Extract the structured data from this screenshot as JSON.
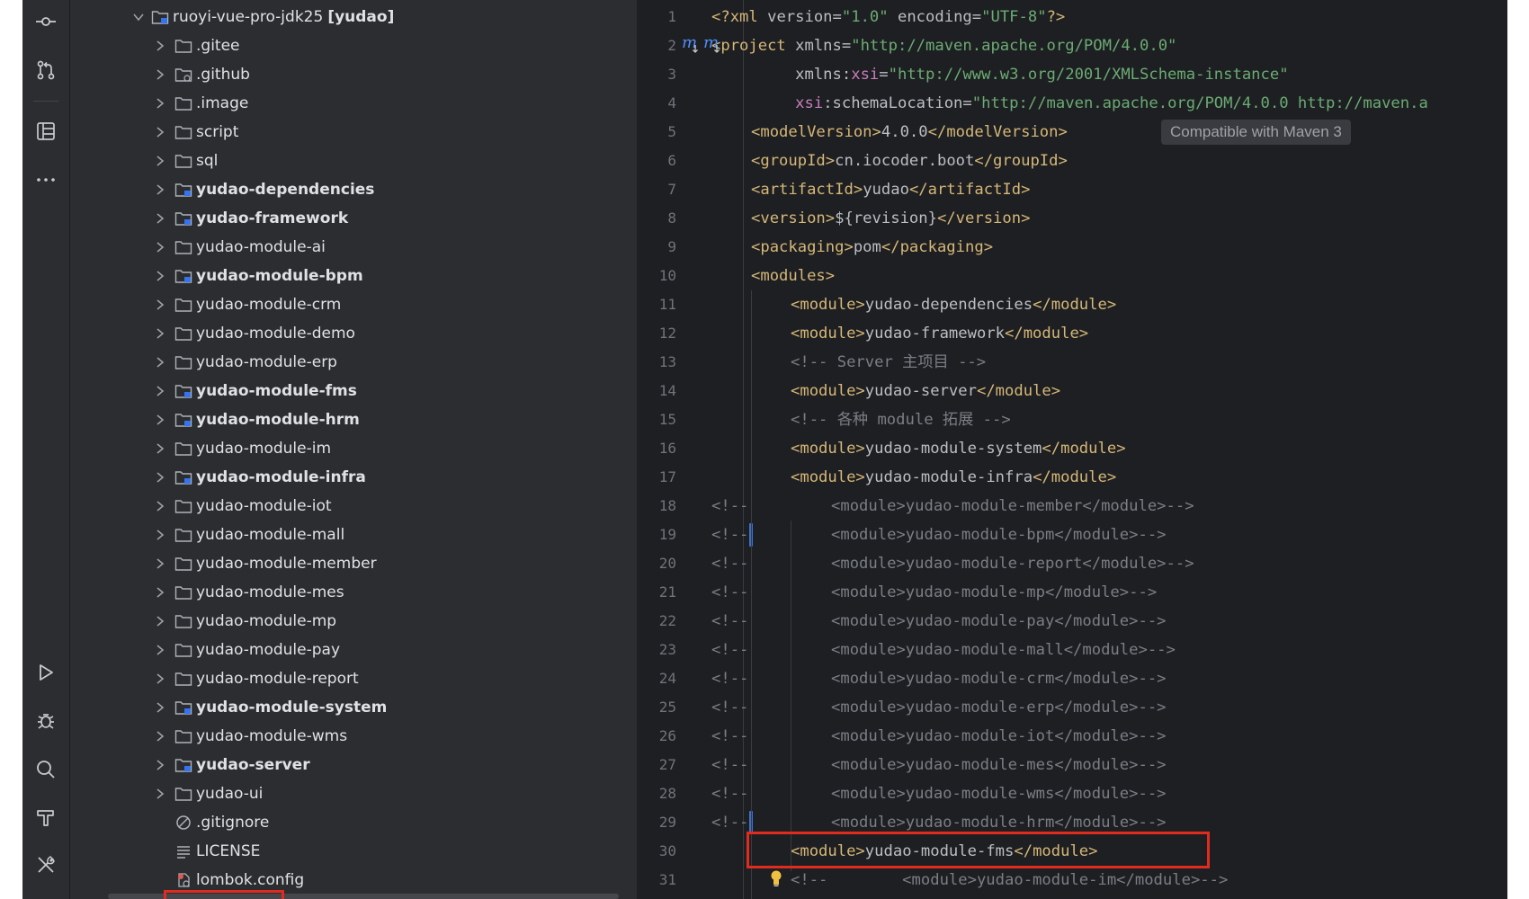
{
  "colors": {
    "background": "#1e1f22",
    "panel": "#2b2d30",
    "tag": "#d5b778",
    "attribute_value": "#6aab73",
    "namespace": "#c77dbb",
    "comment": "#7a7e85",
    "highlight_box": "#e12b1f",
    "change_marker": "#3d6fd0"
  },
  "activity_bar": {
    "top_icons": [
      "commit-icon",
      "pull-requests-icon",
      "structure-icon",
      "more-icon"
    ],
    "bottom_icons": [
      "run-icon",
      "debug-icon",
      "search-icon",
      "build-icon",
      "tools-icon"
    ]
  },
  "project_tree": {
    "root": {
      "label": "ruoyi-vue-pro-jdk25",
      "suffix": "[yudao]"
    },
    "items": [
      {
        "label": ".gitee",
        "type": "folder",
        "bold": false
      },
      {
        "label": ".github",
        "type": "folder-special",
        "bold": false
      },
      {
        "label": ".image",
        "type": "folder",
        "bold": false
      },
      {
        "label": "script",
        "type": "folder",
        "bold": false
      },
      {
        "label": "sql",
        "type": "folder",
        "bold": false
      },
      {
        "label": "yudao-dependencies",
        "type": "module",
        "bold": true
      },
      {
        "label": "yudao-framework",
        "type": "module",
        "bold": true
      },
      {
        "label": "yudao-module-ai",
        "type": "folder",
        "bold": false
      },
      {
        "label": "yudao-module-bpm",
        "type": "module",
        "bold": true
      },
      {
        "label": "yudao-module-crm",
        "type": "folder",
        "bold": false
      },
      {
        "label": "yudao-module-demo",
        "type": "folder",
        "bold": false
      },
      {
        "label": "yudao-module-erp",
        "type": "folder",
        "bold": false
      },
      {
        "label": "yudao-module-fms",
        "type": "module",
        "bold": true
      },
      {
        "label": "yudao-module-hrm",
        "type": "module",
        "bold": true
      },
      {
        "label": "yudao-module-im",
        "type": "folder",
        "bold": false
      },
      {
        "label": "yudao-module-infra",
        "type": "module",
        "bold": true
      },
      {
        "label": "yudao-module-iot",
        "type": "folder",
        "bold": false
      },
      {
        "label": "yudao-module-mall",
        "type": "folder",
        "bold": false
      },
      {
        "label": "yudao-module-member",
        "type": "folder",
        "bold": false
      },
      {
        "label": "yudao-module-mes",
        "type": "folder",
        "bold": false
      },
      {
        "label": "yudao-module-mp",
        "type": "folder",
        "bold": false
      },
      {
        "label": "yudao-module-pay",
        "type": "folder",
        "bold": false
      },
      {
        "label": "yudao-module-report",
        "type": "folder",
        "bold": false
      },
      {
        "label": "yudao-module-system",
        "type": "module",
        "bold": true
      },
      {
        "label": "yudao-module-wms",
        "type": "folder",
        "bold": false
      },
      {
        "label": "yudao-server",
        "type": "module",
        "bold": true
      },
      {
        "label": "yudao-ui",
        "type": "folder",
        "bold": false
      },
      {
        "label": ".gitignore",
        "type": "ignore-file",
        "bold": false
      },
      {
        "label": "LICENSE",
        "type": "text-file",
        "bold": false
      },
      {
        "label": "lombok.config",
        "type": "config-file",
        "bold": false
      }
    ]
  },
  "editor": {
    "inlay_hint": "Compatible with Maven 3",
    "lines": [
      {
        "n": "1",
        "indent": 0,
        "comment_prefix": false,
        "segs": [
          [
            "tag",
            "<?xml "
          ],
          [
            "attr",
            "version="
          ],
          [
            "val",
            "\"1.0\""
          ],
          [
            "attr",
            " encoding="
          ],
          [
            "val",
            "\"UTF-8\""
          ],
          [
            "tag",
            "?>"
          ]
        ]
      },
      {
        "n": "2",
        "indent": 0,
        "comment_prefix": false,
        "segs": [
          [
            "tag",
            "<project "
          ],
          [
            "attr",
            "xmlns="
          ],
          [
            "val",
            "\"http://maven.apache.org/POM/4.0.0\""
          ]
        ]
      },
      {
        "n": "3",
        "indent": 0,
        "comment_prefix": false,
        "segs": [
          [
            "attr",
            "         xmlns:"
          ],
          [
            "ns",
            "xsi"
          ],
          [
            "attr",
            "="
          ],
          [
            "val",
            "\"http://www.w3.org/2001/XMLSchema-instance\""
          ]
        ]
      },
      {
        "n": "4",
        "indent": 0,
        "comment_prefix": false,
        "segs": [
          [
            "ns",
            "         xsi"
          ],
          [
            "attr",
            ":schemaLocation="
          ],
          [
            "val",
            "\"http://maven.apache.org/POM/4.0.0 http://maven.a"
          ]
        ]
      },
      {
        "n": "5",
        "indent": 1,
        "comment_prefix": false,
        "segs": [
          [
            "tag",
            "<modelVersion>"
          ],
          [
            "txt",
            "4.0.0"
          ],
          [
            "tag",
            "</modelVersion>"
          ]
        ]
      },
      {
        "n": "6",
        "indent": 1,
        "comment_prefix": false,
        "segs": [
          [
            "tag",
            "<groupId>"
          ],
          [
            "txt",
            "cn.iocoder.boot"
          ],
          [
            "tag",
            "</groupId>"
          ]
        ]
      },
      {
        "n": "7",
        "indent": 1,
        "comment_prefix": false,
        "segs": [
          [
            "tag",
            "<artifactId>"
          ],
          [
            "txt",
            "yudao"
          ],
          [
            "tag",
            "</artifactId>"
          ]
        ]
      },
      {
        "n": "8",
        "indent": 1,
        "comment_prefix": false,
        "segs": [
          [
            "tag",
            "<version>"
          ],
          [
            "txt",
            "${revision}"
          ],
          [
            "tag",
            "</version>"
          ]
        ]
      },
      {
        "n": "9",
        "indent": 1,
        "comment_prefix": false,
        "segs": [
          [
            "tag",
            "<packaging>"
          ],
          [
            "txt",
            "pom"
          ],
          [
            "tag",
            "</packaging>"
          ]
        ]
      },
      {
        "n": "10",
        "indent": 1,
        "comment_prefix": false,
        "segs": [
          [
            "tag",
            "<modules>"
          ]
        ]
      },
      {
        "n": "11",
        "indent": 2,
        "comment_prefix": false,
        "segs": [
          [
            "tag",
            "<module>"
          ],
          [
            "txt",
            "yudao-dependencies"
          ],
          [
            "tag",
            "</module>"
          ]
        ]
      },
      {
        "n": "12",
        "indent": 2,
        "comment_prefix": false,
        "segs": [
          [
            "tag",
            "<module>"
          ],
          [
            "txt",
            "yudao-framework"
          ],
          [
            "tag",
            "</module>"
          ]
        ]
      },
      {
        "n": "13",
        "indent": 2,
        "comment_prefix": false,
        "segs": [
          [
            "cmt",
            "<!-- Server 主项目 -->"
          ]
        ]
      },
      {
        "n": "14",
        "indent": 2,
        "comment_prefix": false,
        "segs": [
          [
            "tag",
            "<module>"
          ],
          [
            "txt",
            "yudao-server"
          ],
          [
            "tag",
            "</module>"
          ]
        ]
      },
      {
        "n": "15",
        "indent": 2,
        "comment_prefix": false,
        "segs": [
          [
            "cmt",
            "<!-- 各种 module 拓展 -->"
          ]
        ]
      },
      {
        "n": "16",
        "indent": 2,
        "comment_prefix": false,
        "segs": [
          [
            "tag",
            "<module>"
          ],
          [
            "txt",
            "yudao-module-system"
          ],
          [
            "tag",
            "</module>"
          ]
        ]
      },
      {
        "n": "17",
        "indent": 2,
        "comment_prefix": false,
        "segs": [
          [
            "tag",
            "<module>"
          ],
          [
            "txt",
            "yudao-module-infra"
          ],
          [
            "tag",
            "</module>"
          ]
        ]
      },
      {
        "n": "18",
        "indent": 3,
        "comment_prefix": true,
        "segs": [
          [
            "cmt",
            "<module>yudao-module-member</module>-->"
          ]
        ]
      },
      {
        "n": "19",
        "indent": 3,
        "comment_prefix": true,
        "segs": [
          [
            "cmt",
            "<module>yudao-module-bpm</module>-->"
          ]
        ]
      },
      {
        "n": "20",
        "indent": 3,
        "comment_prefix": true,
        "segs": [
          [
            "cmt",
            "<module>yudao-module-report</module>-->"
          ]
        ]
      },
      {
        "n": "21",
        "indent": 3,
        "comment_prefix": true,
        "segs": [
          [
            "cmt",
            "<module>yudao-module-mp</module>-->"
          ]
        ]
      },
      {
        "n": "22",
        "indent": 3,
        "comment_prefix": true,
        "segs": [
          [
            "cmt",
            "<module>yudao-module-pay</module>-->"
          ]
        ]
      },
      {
        "n": "23",
        "indent": 3,
        "comment_prefix": true,
        "segs": [
          [
            "cmt",
            "<module>yudao-module-mall</module>-->"
          ]
        ]
      },
      {
        "n": "24",
        "indent": 3,
        "comment_prefix": true,
        "segs": [
          [
            "cmt",
            "<module>yudao-module-crm</module>-->"
          ]
        ]
      },
      {
        "n": "25",
        "indent": 3,
        "comment_prefix": true,
        "segs": [
          [
            "cmt",
            "<module>yudao-module-erp</module>-->"
          ]
        ]
      },
      {
        "n": "26",
        "indent": 3,
        "comment_prefix": true,
        "segs": [
          [
            "cmt",
            "<module>yudao-module-iot</module>-->"
          ]
        ]
      },
      {
        "n": "27",
        "indent": 3,
        "comment_prefix": true,
        "segs": [
          [
            "cmt",
            "<module>yudao-module-mes</module>-->"
          ]
        ]
      },
      {
        "n": "28",
        "indent": 3,
        "comment_prefix": true,
        "segs": [
          [
            "cmt",
            "<module>yudao-module-wms</module>-->"
          ]
        ]
      },
      {
        "n": "29",
        "indent": 3,
        "comment_prefix": true,
        "segs": [
          [
            "cmt",
            "<module>yudao-module-hrm</module>-->"
          ]
        ]
      },
      {
        "n": "30",
        "indent": 2,
        "comment_prefix": false,
        "segs": [
          [
            "tag",
            "<module>"
          ],
          [
            "txt",
            "yudao-module-fms"
          ],
          [
            "tag",
            "</module>"
          ]
        ]
      },
      {
        "n": "31",
        "indent": 2,
        "comment_prefix": false,
        "segs": [
          [
            "cmt",
            "<!--        <module>yudao-module-im</module>-->"
          ]
        ]
      }
    ],
    "comment_prefix_text": "<!--"
  }
}
